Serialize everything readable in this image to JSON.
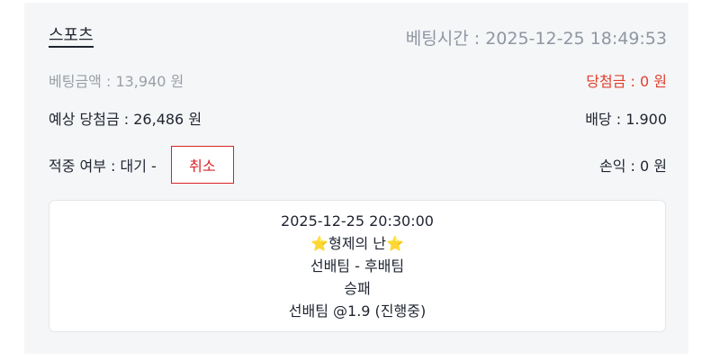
{
  "header": {
    "category": "스포츠",
    "bet_time": "베팅시간 : 2025-12-25 18:49:53"
  },
  "summary": {
    "bet_amount": "베팅금액 : 13,940 원",
    "win_amount": "당첨금 : 0 원",
    "expected_win": "예상 당첨금 : 26,486 원",
    "odds": "배당 : 1.900",
    "hit_status": "적중 여부 : 대기 -",
    "cancel_label": "취소",
    "profit": "손익 : 0 원"
  },
  "detail": {
    "datetime": "2025-12-25 20:30:00",
    "star_icon": "star-icon",
    "match_title": "형제의 난",
    "teams": "선배팀 - 후배팀",
    "market": "승패",
    "selection": "선배팀 @1.9 (진행중)"
  },
  "colors": {
    "accent_red": "#d8232a",
    "win_red": "#e0402e",
    "muted": "#9aa0a8",
    "star": "#f7b500"
  }
}
